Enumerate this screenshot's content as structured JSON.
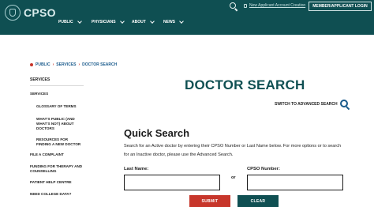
{
  "header": {
    "logo_text": "CPSO",
    "new_account_link": "New Applicant Account Creation",
    "login_button": "MEMBER/APPLICANT LOGIN",
    "nav": [
      {
        "label": "PUBLIC"
      },
      {
        "label": "PHYSICIANS"
      },
      {
        "label": "ABOUT"
      },
      {
        "label": "NEWS"
      }
    ]
  },
  "breadcrumb": [
    "PUBLIC",
    "SERVICES",
    "DOCTOR SEARCH"
  ],
  "sidebar": {
    "heading": "SERVICES",
    "items": [
      {
        "label": "SERVICES"
      },
      {
        "label": "GLOSSARY OF TERMS"
      },
      {
        "label": "WHAT'S PUBLIC (AND WHAT'S NOT) ABOUT DOCTORS"
      },
      {
        "label": "RESOURCES FOR FINDING A NEW DOCTOR"
      },
      {
        "label": "FILE A COMPLAINT"
      },
      {
        "label": "FUNDING FOR THERAPY AND COUNSELLING"
      },
      {
        "label": "PATIENT HELP CENTRE"
      },
      {
        "label": "NEED COLLEGE DATA?"
      }
    ]
  },
  "main": {
    "title": "DOCTOR SEARCH",
    "advanced_link": "SWITCH TO ADVANCED SEARCH",
    "quick_search_title": "Quick Search",
    "description": "Search for an Active doctor by entering their CPSO Number or Last Name below. For more options or to search for an Inactive doctor, please use the Advanced Search.",
    "last_name_label": "Last Name:",
    "cpso_label": "CPSO Number:",
    "or_text": "or",
    "last_name_value": "",
    "cpso_value": "",
    "submit_label": "SUBMIT",
    "clear_label": "CLEAR"
  },
  "colors": {
    "header_bg": "#0f4f52",
    "accent_red": "#c7362b",
    "link_blue": "#1a5b8c"
  }
}
